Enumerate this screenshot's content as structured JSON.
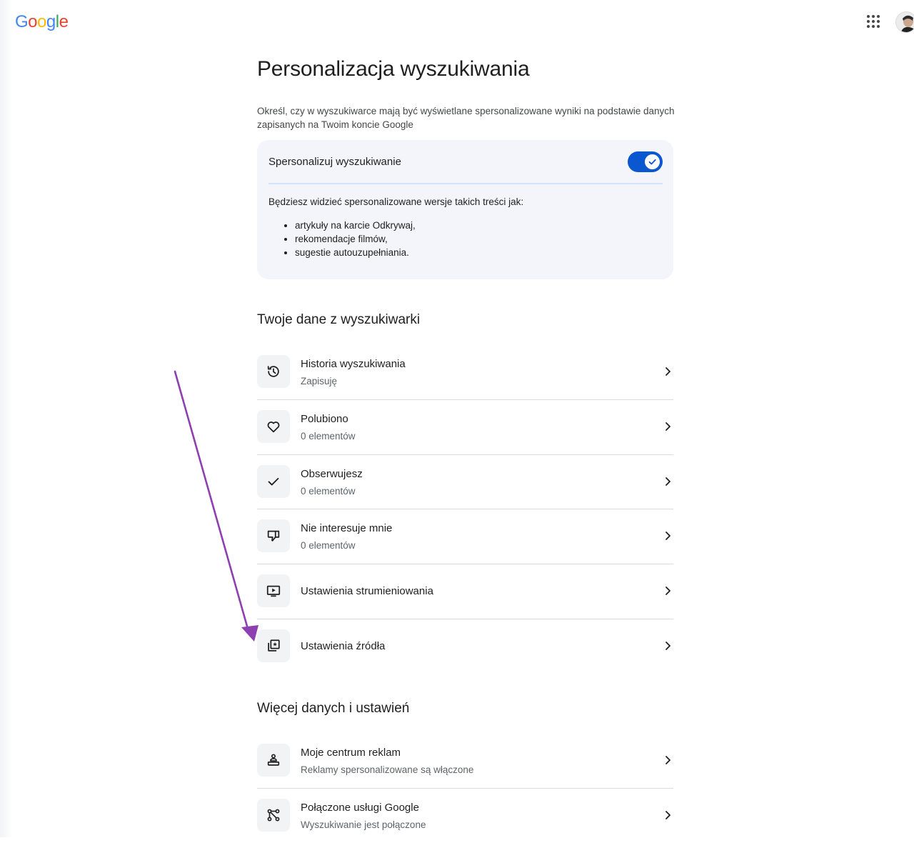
{
  "header": {
    "logo_letters": [
      {
        "char": "G",
        "color": "#4285F4"
      },
      {
        "char": "o",
        "color": "#EA4335"
      },
      {
        "char": "o",
        "color": "#FBBC05"
      },
      {
        "char": "g",
        "color": "#4285F4"
      },
      {
        "char": "l",
        "color": "#34A853"
      },
      {
        "char": "e",
        "color": "#EA4335"
      }
    ],
    "apps_icon": "apps-grid-icon",
    "avatar": "account-avatar"
  },
  "page": {
    "title": "Personalizacja wyszukiwania",
    "intro": "Określ, czy w wyszukiwarce mają być wyświetlane spersonalizowane wyniki na podstawie danych zapisanych na Twoim koncie Google"
  },
  "personalize_card": {
    "title": "Spersonalizuj wyszukiwanie",
    "toggle_on": true,
    "description": "Będziesz widzieć spersonalizowane wersje takich treści jak:",
    "bullets": [
      "artykuły na karcie Odkrywaj,",
      "rekomendacje filmów,",
      "sugestie autouzupełniania."
    ]
  },
  "search_data": {
    "heading": "Twoje dane z wyszukiwarki",
    "items": [
      {
        "title": "Historia wyszukiwania",
        "subtitle": "Zapisuję",
        "icon": "history-icon"
      },
      {
        "title": "Polubiono",
        "subtitle": "0 elementów",
        "icon": "heart-icon"
      },
      {
        "title": "Obserwujesz",
        "subtitle": "0 elementów",
        "icon": "check-icon"
      },
      {
        "title": "Nie interesuje mnie",
        "subtitle": "0 elementów",
        "icon": "thumb-down-icon"
      },
      {
        "title": "Ustawienia strumieniowania",
        "subtitle": "",
        "icon": "tv-play-icon"
      },
      {
        "title": "Ustawienia źródła",
        "subtitle": "",
        "icon": "source-star-icon"
      }
    ]
  },
  "more_data": {
    "heading": "Więcej danych i ustawień",
    "items": [
      {
        "title": "Moje centrum reklam",
        "subtitle": "Reklamy spersonalizowane są włączone",
        "icon": "ad-center-icon"
      },
      {
        "title": "Połączone usługi Google",
        "subtitle": "Wyszukiwanie jest połączone",
        "icon": "linked-services-icon"
      }
    ]
  },
  "annotation": {
    "arrow_color": "#8e3fb0"
  },
  "colors": {
    "toggle_on": "#0b57d0",
    "card_bg": "#f3f5fa"
  }
}
